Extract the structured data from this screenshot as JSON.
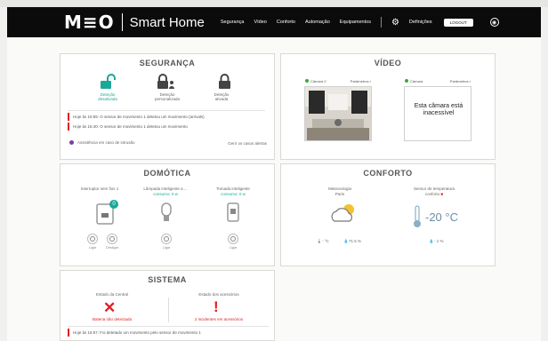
{
  "header": {
    "brand": "M≡O",
    "subtitle": "Smart Home",
    "nav": [
      "Segurança",
      "Vídeo",
      "Conforto",
      "Automação",
      "Equipamentos"
    ],
    "settings_label": "Definições",
    "logout_label": "LOGOUT"
  },
  "security": {
    "title": "SEGURANÇA",
    "modes": [
      {
        "label": "Deteção desativada",
        "active": true
      },
      {
        "label": "Deteção personalizada",
        "active": false
      },
      {
        "label": "Deteção ativada",
        "active": false
      }
    ],
    "events": [
      "Hoje às 16:55: O sensor de movimento 1 detetou um movimento (arrivals)",
      "Hoje às 16:40: O sensor de movimento 1 detetou um movimento"
    ],
    "assist_label": "Assistência em caso de intrusão",
    "more_link": "Gerir os casos alertas"
  },
  "video": {
    "title": "VÍDEO",
    "cam1": {
      "name": "Câmara 2",
      "menu": "Parâmetros"
    },
    "cam2": {
      "name": "Câmara",
      "menu": "Parâmetros",
      "message": "Esta câmara está inacessível"
    }
  },
  "domotics": {
    "title": "DOMÓTICA",
    "devices": [
      {
        "label": "Interruptor sem fios 1",
        "status": "",
        "badge": "0",
        "buttons": [
          "Ligar",
          "Desligar"
        ]
      },
      {
        "label": "Lâmpada inteligente a ...",
        "status": "consumo: 0 w",
        "badge": "",
        "buttons": [
          "Ligar"
        ]
      },
      {
        "label": "Tomada inteligente",
        "status": "consumo: 0 w",
        "badge": "",
        "buttons": [
          "Ligar"
        ]
      }
    ]
  },
  "comfort": {
    "title": "CONFORTO",
    "weather": {
      "label": "Meteorologia",
      "city": "Paris",
      "temp": "- °C",
      "humidity": "71.5 %"
    },
    "sensor": {
      "label": "Sensor de temperatura",
      "sublabel": "conforto",
      "temp": "-20 °C",
      "humidity": "- 1 %"
    }
  },
  "system": {
    "title": "SISTEMA",
    "central_label": "Estado da Central",
    "central_status": "Bateria não detectada",
    "accessories_label": "Estado dos acessórios",
    "accessories_status": "2 incidentes em acessórios",
    "event": "Hoje às 16:57: Foi detetado um movimento pelo sensor de movimento 1"
  },
  "colors": {
    "accent": "#1aa89a",
    "alert": "#e02020",
    "online": "#3aa93a",
    "topbar": "#0b0b0b"
  }
}
